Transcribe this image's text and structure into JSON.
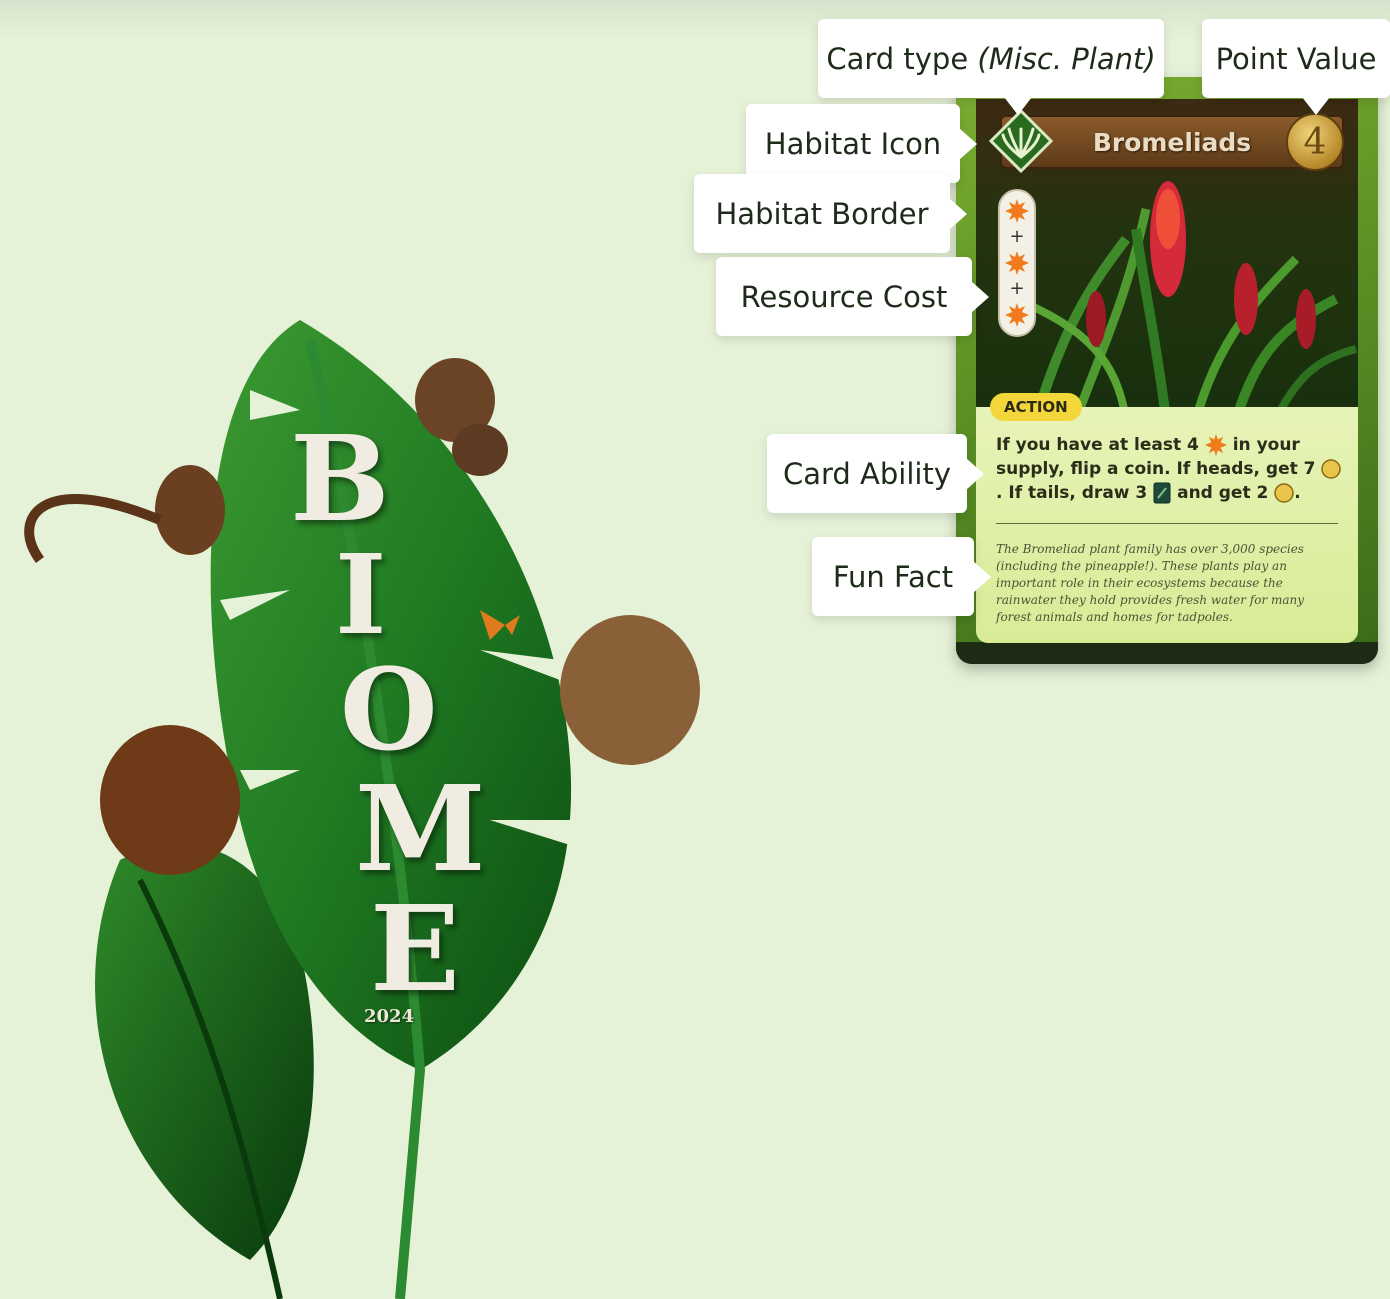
{
  "poster": {
    "title_letters": [
      "B",
      "I",
      "O",
      "M",
      "E"
    ],
    "year": "2024"
  },
  "callouts": {
    "card_type": "Card type",
    "card_type_detail": "(Misc. Plant)",
    "point_value": "Point Value",
    "habitat_icon": "Habitat Icon",
    "habitat_border": "Habitat Border",
    "resource_cost": "Resource Cost",
    "card_ability": "Card Ability",
    "fun_fact": "Fun Fact"
  },
  "card": {
    "title": "Bromeliads",
    "points": "4",
    "cost_icons": [
      "sun-resource-icon",
      "sun-resource-icon",
      "sun-resource-icon"
    ],
    "action_label": "ACTION",
    "ability": {
      "part1": "If you have at least 4",
      "part2": "in your supply, flip a coin. If heads, get 7",
      "part3": ". If tails, draw 3",
      "part4": "and get 2",
      "part5": "."
    },
    "fun_fact": "The Bromeliad plant family has over 3,000 species (including the pineapple!). These plants play an important role in their ecosystems because the rainwater they hold provides fresh water for many forest animals and homes for tadpoles."
  },
  "colors": {
    "background": "#e6f2d8",
    "card_border": "#5e9426",
    "action_badge": "#f2d63a",
    "sun_resource": "#f07a1c",
    "coin": "#e8c54a"
  }
}
